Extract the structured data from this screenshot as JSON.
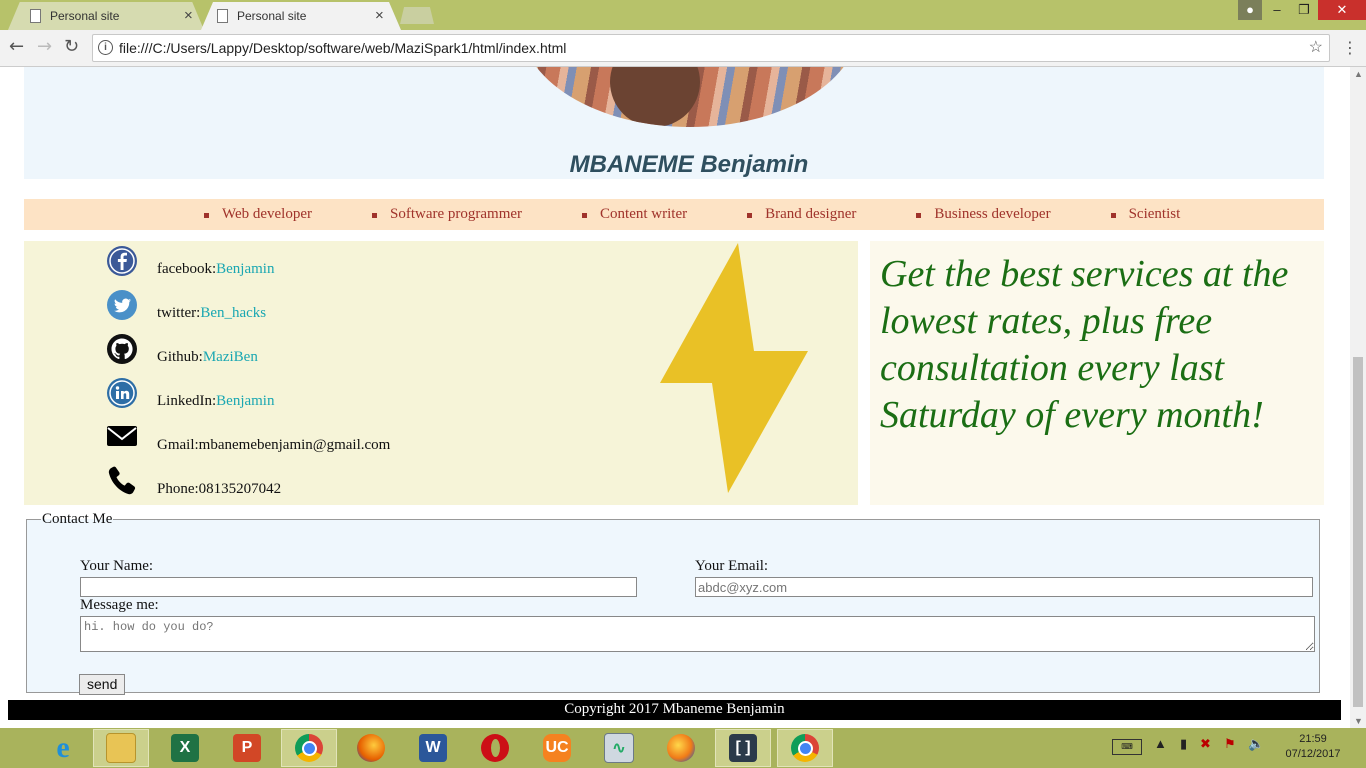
{
  "browser": {
    "tabs": [
      {
        "title": "Personal site",
        "active": false
      },
      {
        "title": "Personal site",
        "active": true
      }
    ],
    "url": "file:///C:/Users/Lappy/Desktop/software/web/MaziSpark1/html/index.html"
  },
  "page": {
    "name": "MBANEME Benjamin",
    "nav_items": [
      "Web developer",
      "Software programmer",
      "Content writer",
      "Brand designer",
      "Business developer",
      "Scientist"
    ],
    "contacts": [
      {
        "label": "facebook:",
        "value": "Benjamin",
        "icon": "facebook-icon",
        "link": true
      },
      {
        "label": "twitter:",
        "value": "Ben_hacks",
        "icon": "twitter-icon",
        "link": true
      },
      {
        "label": "Github:",
        "value": "MaziBen",
        "icon": "github-icon",
        "link": true
      },
      {
        "label": "LinkedIn:",
        "value": "Benjamin",
        "icon": "linkedin-icon",
        "link": true
      },
      {
        "label": "Gmail:",
        "value": "mbanemebenjamin@gmail.com",
        "icon": "mail-icon",
        "link": false
      },
      {
        "label": "Phone:",
        "value": "08135207042",
        "icon": "phone-icon",
        "link": false
      }
    ],
    "promo": "Get the best services at the lowest rates, plus free consultation every last Saturday of every month!",
    "contact_form": {
      "legend": "Contact Me",
      "name_label": "Your Name:",
      "name_value": "",
      "email_label": "Your Email:",
      "email_placeholder": "abdc@xyz.com",
      "message_label": "Message me:",
      "message_placeholder": "hi. how do you do?",
      "send_label": "send"
    },
    "footer": "Copyright 2017 Mbaneme Benjamin"
  },
  "taskbar": {
    "clock_time": "21:59",
    "clock_date": "07/12/2017",
    "apps": [
      "internet-explorer-icon",
      "file-explorer-icon",
      "excel-icon",
      "powerpoint-icon",
      "chrome-icon",
      "firefox-icon",
      "word-icon",
      "opera-icon",
      "uc-browser-icon",
      "task-manager-icon",
      "firefox-alt-icon",
      "brackets-icon",
      "chrome-active-icon"
    ]
  },
  "colors": {
    "nav_bg": "#fde3c5",
    "nav_text": "#a0332b",
    "link": "#1aa7b2",
    "promo_text": "#1b6e14",
    "header_bg": "#eef6fc",
    "taskbar_bg": "#a9b35c"
  }
}
